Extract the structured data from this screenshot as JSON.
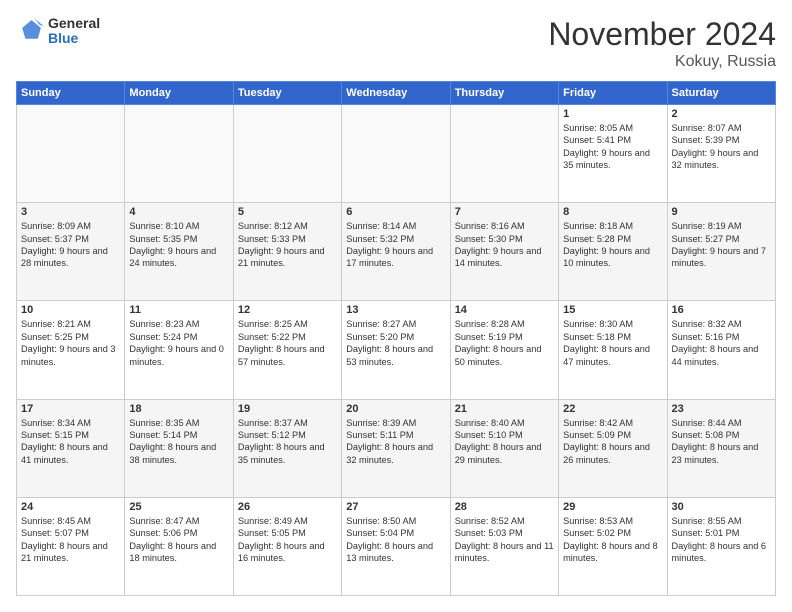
{
  "header": {
    "logo_general": "General",
    "logo_blue": "Blue",
    "month_title": "November 2024",
    "location": "Kokuy, Russia"
  },
  "days_of_week": [
    "Sunday",
    "Monday",
    "Tuesday",
    "Wednesday",
    "Thursday",
    "Friday",
    "Saturday"
  ],
  "weeks": [
    [
      {
        "day": "",
        "text": ""
      },
      {
        "day": "",
        "text": ""
      },
      {
        "day": "",
        "text": ""
      },
      {
        "day": "",
        "text": ""
      },
      {
        "day": "",
        "text": ""
      },
      {
        "day": "1",
        "text": "Sunrise: 8:05 AM\nSunset: 5:41 PM\nDaylight: 9 hours and 35 minutes."
      },
      {
        "day": "2",
        "text": "Sunrise: 8:07 AM\nSunset: 5:39 PM\nDaylight: 9 hours and 32 minutes."
      }
    ],
    [
      {
        "day": "3",
        "text": "Sunrise: 8:09 AM\nSunset: 5:37 PM\nDaylight: 9 hours and 28 minutes."
      },
      {
        "day": "4",
        "text": "Sunrise: 8:10 AM\nSunset: 5:35 PM\nDaylight: 9 hours and 24 minutes."
      },
      {
        "day": "5",
        "text": "Sunrise: 8:12 AM\nSunset: 5:33 PM\nDaylight: 9 hours and 21 minutes."
      },
      {
        "day": "6",
        "text": "Sunrise: 8:14 AM\nSunset: 5:32 PM\nDaylight: 9 hours and 17 minutes."
      },
      {
        "day": "7",
        "text": "Sunrise: 8:16 AM\nSunset: 5:30 PM\nDaylight: 9 hours and 14 minutes."
      },
      {
        "day": "8",
        "text": "Sunrise: 8:18 AM\nSunset: 5:28 PM\nDaylight: 9 hours and 10 minutes."
      },
      {
        "day": "9",
        "text": "Sunrise: 8:19 AM\nSunset: 5:27 PM\nDaylight: 9 hours and 7 minutes."
      }
    ],
    [
      {
        "day": "10",
        "text": "Sunrise: 8:21 AM\nSunset: 5:25 PM\nDaylight: 9 hours and 3 minutes."
      },
      {
        "day": "11",
        "text": "Sunrise: 8:23 AM\nSunset: 5:24 PM\nDaylight: 9 hours and 0 minutes."
      },
      {
        "day": "12",
        "text": "Sunrise: 8:25 AM\nSunset: 5:22 PM\nDaylight: 8 hours and 57 minutes."
      },
      {
        "day": "13",
        "text": "Sunrise: 8:27 AM\nSunset: 5:20 PM\nDaylight: 8 hours and 53 minutes."
      },
      {
        "day": "14",
        "text": "Sunrise: 8:28 AM\nSunset: 5:19 PM\nDaylight: 8 hours and 50 minutes."
      },
      {
        "day": "15",
        "text": "Sunrise: 8:30 AM\nSunset: 5:18 PM\nDaylight: 8 hours and 47 minutes."
      },
      {
        "day": "16",
        "text": "Sunrise: 8:32 AM\nSunset: 5:16 PM\nDaylight: 8 hours and 44 minutes."
      }
    ],
    [
      {
        "day": "17",
        "text": "Sunrise: 8:34 AM\nSunset: 5:15 PM\nDaylight: 8 hours and 41 minutes."
      },
      {
        "day": "18",
        "text": "Sunrise: 8:35 AM\nSunset: 5:14 PM\nDaylight: 8 hours and 38 minutes."
      },
      {
        "day": "19",
        "text": "Sunrise: 8:37 AM\nSunset: 5:12 PM\nDaylight: 8 hours and 35 minutes."
      },
      {
        "day": "20",
        "text": "Sunrise: 8:39 AM\nSunset: 5:11 PM\nDaylight: 8 hours and 32 minutes."
      },
      {
        "day": "21",
        "text": "Sunrise: 8:40 AM\nSunset: 5:10 PM\nDaylight: 8 hours and 29 minutes."
      },
      {
        "day": "22",
        "text": "Sunrise: 8:42 AM\nSunset: 5:09 PM\nDaylight: 8 hours and 26 minutes."
      },
      {
        "day": "23",
        "text": "Sunrise: 8:44 AM\nSunset: 5:08 PM\nDaylight: 8 hours and 23 minutes."
      }
    ],
    [
      {
        "day": "24",
        "text": "Sunrise: 8:45 AM\nSunset: 5:07 PM\nDaylight: 8 hours and 21 minutes."
      },
      {
        "day": "25",
        "text": "Sunrise: 8:47 AM\nSunset: 5:06 PM\nDaylight: 8 hours and 18 minutes."
      },
      {
        "day": "26",
        "text": "Sunrise: 8:49 AM\nSunset: 5:05 PM\nDaylight: 8 hours and 16 minutes."
      },
      {
        "day": "27",
        "text": "Sunrise: 8:50 AM\nSunset: 5:04 PM\nDaylight: 8 hours and 13 minutes."
      },
      {
        "day": "28",
        "text": "Sunrise: 8:52 AM\nSunset: 5:03 PM\nDaylight: 8 hours and 11 minutes."
      },
      {
        "day": "29",
        "text": "Sunrise: 8:53 AM\nSunset: 5:02 PM\nDaylight: 8 hours and 8 minutes."
      },
      {
        "day": "30",
        "text": "Sunrise: 8:55 AM\nSunset: 5:01 PM\nDaylight: 8 hours and 6 minutes."
      }
    ]
  ]
}
